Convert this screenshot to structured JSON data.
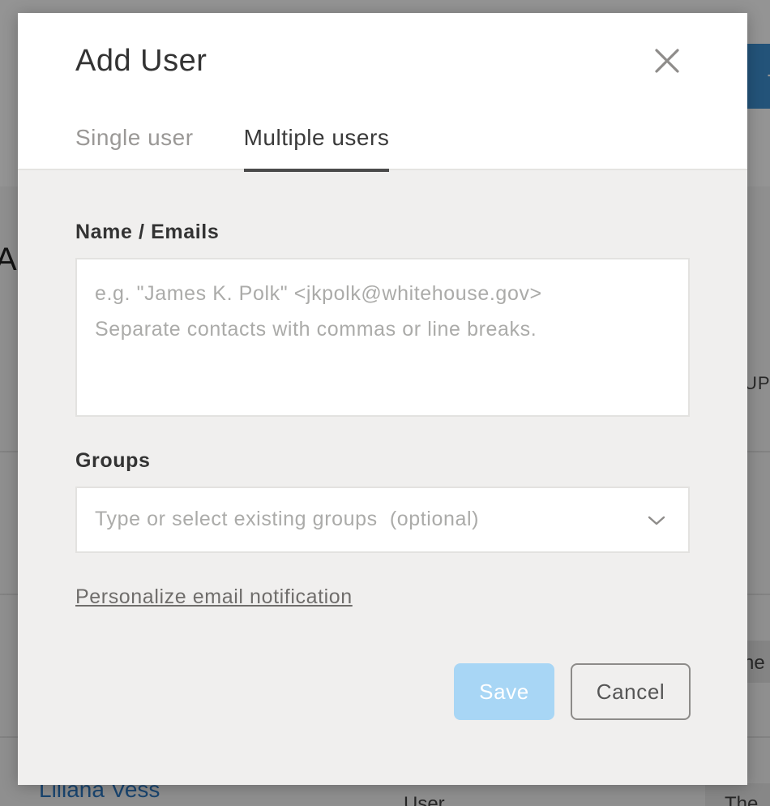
{
  "background": {
    "title_fragment": "Al",
    "column_fragment": "UP",
    "cell_fragment": "ne",
    "user_link": "Liliana Vess",
    "user_role": "User",
    "bottom_cell_fragment": "The",
    "button_fragment": "+"
  },
  "modal": {
    "title": "Add User",
    "tabs": [
      {
        "label": "Single user",
        "active": false
      },
      {
        "label": "Multiple users",
        "active": true
      }
    ],
    "emails": {
      "label": "Name / Emails",
      "value": "",
      "placeholder": "e.g. \"James K. Polk\" <jkpolk@whitehouse.gov>\nSeparate contacts with commas or line breaks."
    },
    "groups": {
      "label": "Groups",
      "placeholder": "Type or select existing groups  (optional)"
    },
    "personalize_link": "Personalize email notification",
    "save_label": "Save",
    "cancel_label": "Cancel"
  },
  "colors": {
    "accent_disabled": "#a8d6f5",
    "background_button": "#3d8fd1",
    "link_blue": "#2b78c2"
  },
  "icons": {
    "close": "close-icon",
    "dropdown": "chevron-down-icon"
  }
}
